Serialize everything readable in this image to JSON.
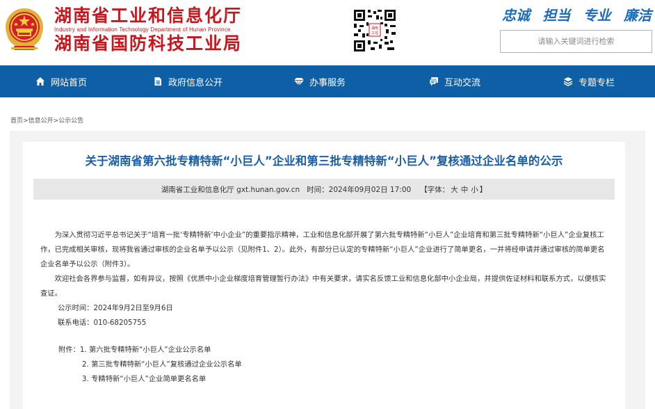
{
  "header": {
    "title_cn": "湖南省工业和信息化厅",
    "title_en": "Industry and Information Technology Department of Hunan Province",
    "title_sub": "湖南省国防科技工业局",
    "slogan": [
      "忠诚",
      "担当",
      "专业",
      "廉洁"
    ],
    "search_placeholder": "请输入关键词进行检索",
    "colors": {
      "brand_red": "#c8161d",
      "brand_blue": "#0f5fa6",
      "slogan_blue": "#1b6bbd"
    }
  },
  "nav": {
    "items": [
      {
        "label": "网站首页",
        "icon": "home-icon"
      },
      {
        "label": "政府信息公开",
        "icon": "document-icon"
      },
      {
        "label": "办事服务",
        "icon": "diamond-icon"
      },
      {
        "label": "互动交流",
        "icon": "chat-icon"
      },
      {
        "label": "专题专栏",
        "icon": "layers-icon"
      }
    ]
  },
  "breadcrumb": {
    "items": [
      "首页",
      "信息公开",
      "公示公告"
    ],
    "separator": ">"
  },
  "article": {
    "title": "关于湖南省第六批专精特新“小巨人”企业和第三批专精特新“小巨人”复核通过企业名单的公示",
    "source": "湖南省工业和信息化厅 gxt.hunan.gov.cn",
    "time_label": "时间：",
    "time": "2024年09月02日 17:00",
    "font_size_label": "【字体：",
    "font_size_options": [
      "大",
      "中",
      "小"
    ],
    "font_size_close": "】",
    "paragraphs": [
      "为深入贯彻习近平总书记关于“培育一批‘专精特新’中小企业”的重要指示精神，工业和信息化部开展了第六批专精特新“小巨人”企业培育和第三批专精特新“小巨人”企业复核工作，已完成相关审核，现将我省通过审核的企业名单予以公示（见附件1、2）。此外，有部分已认定的专精特新“小巨人”企业进行了简单更名，一并将经申请并通过审核的简单更名企业名单予以公示（附件3）。",
      "欢迎社会各界参与监督，如有异议，按照《优质中小企业梯度培育管理暂行办法》中有关要求，请实名反馈工业和信息化部中小企业局，并提供佐证材料和联系方式，以便核实查证。"
    ],
    "publicity_time": "公示时间：2024年9月2日至9月6日",
    "contact_phone": "联系电话：010-68205755",
    "attachments_label": "附件：",
    "attachments": [
      "1. 第六批专精特新“小巨人”企业公示名单",
      "2. 第三批专精特新“小巨人”复核通过企业公示名单",
      "3. 专精特新“小巨人”企业简单更名名单"
    ]
  }
}
